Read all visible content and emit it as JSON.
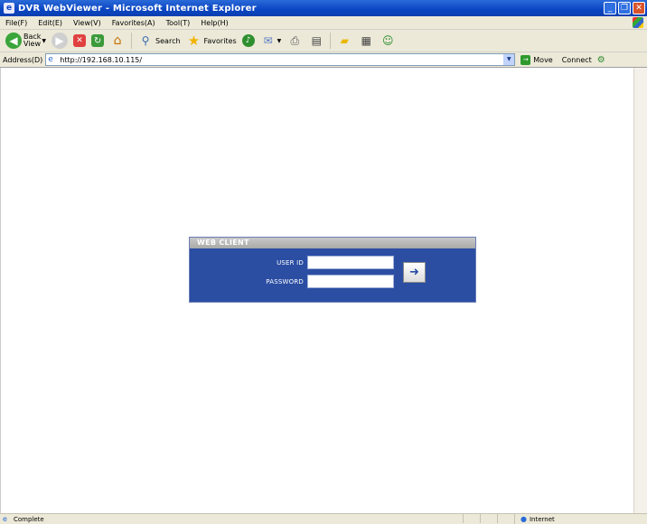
{
  "window": {
    "title": "DVR WebViewer - Microsoft Internet Explorer",
    "icon": "ie-icon"
  },
  "menu": [
    "File(F)",
    "Edit(E)",
    "View(V)",
    "Favorites(A)",
    "Tool(T)",
    "Help(H)"
  ],
  "toolbar": {
    "back_label": "Back\nView",
    "search_label": "Search",
    "favorites_label": "Favorites"
  },
  "address": {
    "label": "Address(D)",
    "url": "http://192.168.10.115/",
    "go_label": "Move",
    "links_label": "Connect"
  },
  "login": {
    "header": "WEB CLIENT",
    "user_label": "USER ID",
    "password_label": "PASSWORD",
    "user_value": "",
    "password_value": "",
    "submit_icon": "arrow-right-icon"
  },
  "status": {
    "text": "Complete",
    "zone": "Internet"
  },
  "colors": {
    "panel_bg": "#2b4ea3",
    "panel_header": "#a9a9a9",
    "titlebar": "#0a45c2"
  }
}
